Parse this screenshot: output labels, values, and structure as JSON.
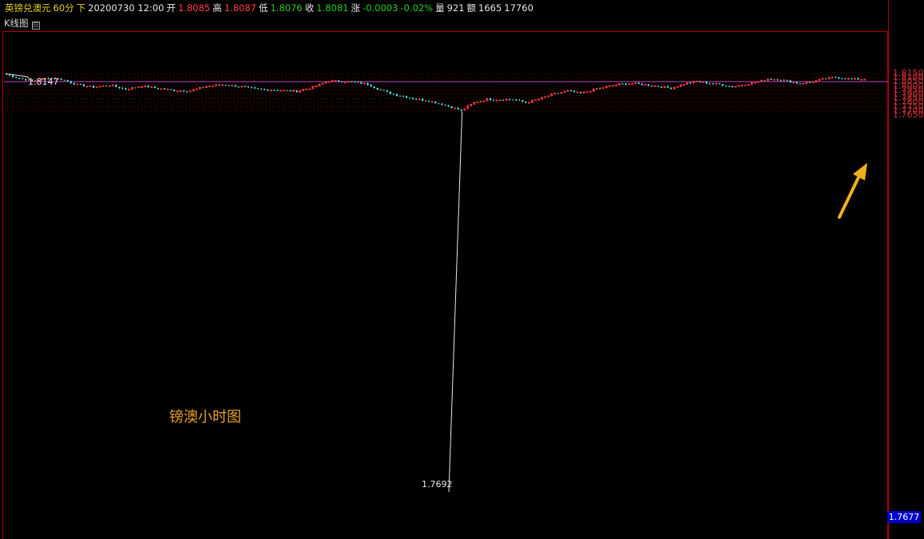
{
  "header": {
    "symbol": "英镑兑澳元",
    "period": "60分",
    "flag": "下",
    "datetime": "20200730 12:00",
    "open_label": "开",
    "open": "1.8085",
    "high_label": "高",
    "high": "1.8087",
    "low_label": "低",
    "low": "1.8076",
    "close_label": "收",
    "close": "1.8081",
    "change_label": "涨",
    "change": "-0.0003",
    "change_pct": "-0.02%",
    "volume_label": "量",
    "volume": "921",
    "amount_label": "额",
    "amount": "1665",
    "extra": "17760"
  },
  "panel": {
    "title": "K线图",
    "collapse_icon": "⊟"
  },
  "annotation": "镑澳小时图",
  "current_price": "1.7677",
  "colors": {
    "up": "#ff3c3c",
    "down": "#54ffff",
    "hline": "#c040c0",
    "arrow": "#f0b020",
    "grid": "#7a0000",
    "axis": "#b00000"
  },
  "chart_data": {
    "type": "candlestick",
    "yticks": [
      "1.8150",
      "1.8100",
      "1.8050",
      "1.8000",
      "1.7950",
      "1.7900",
      "1.7850",
      "1.7800",
      "1.7750",
      "1.7700",
      "1.7650"
    ],
    "ylim": [
      1.764,
      1.8175
    ],
    "high_marker": "1.8147",
    "low_marker": "1.7692",
    "horizontal_line": 1.8051,
    "anchors": [
      [
        0,
        1.814
      ],
      [
        3,
        1.81
      ],
      [
        8,
        1.806
      ],
      [
        13,
        1.8095
      ],
      [
        17,
        1.808
      ],
      [
        22,
        1.8015
      ],
      [
        27,
        1.7985
      ],
      [
        32,
        1.801
      ],
      [
        37,
        1.796
      ],
      [
        42,
        1.8
      ],
      [
        47,
        1.797
      ],
      [
        52,
        1.7945
      ],
      [
        57,
        1.794
      ],
      [
        62,
        1.7995
      ],
      [
        67,
        1.8015
      ],
      [
        72,
        1.7995
      ],
      [
        78,
        1.796
      ],
      [
        84,
        1.795
      ],
      [
        90,
        1.7935
      ],
      [
        95,
        1.7985
      ],
      [
        100,
        1.806
      ],
      [
        104,
        1.8055
      ],
      [
        108,
        1.8045
      ],
      [
        112,
        1.802
      ],
      [
        116,
        1.795
      ],
      [
        120,
        1.79
      ],
      [
        126,
        1.785
      ],
      [
        131,
        1.782
      ],
      [
        136,
        1.777
      ],
      [
        141,
        1.7705
      ],
      [
        145,
        1.78
      ],
      [
        149,
        1.784
      ],
      [
        153,
        1.7835
      ],
      [
        157,
        1.784
      ],
      [
        161,
        1.78
      ],
      [
        165,
        1.784
      ],
      [
        169,
        1.7895
      ],
      [
        174,
        1.794
      ],
      [
        178,
        1.791
      ],
      [
        182,
        1.7955
      ],
      [
        186,
        1.799
      ],
      [
        190,
        1.802
      ],
      [
        194,
        1.803
      ],
      [
        198,
        1.8015
      ],
      [
        202,
        1.7995
      ],
      [
        206,
        1.7975
      ],
      [
        210,
        1.8025
      ],
      [
        214,
        1.8055
      ],
      [
        217,
        1.8035
      ],
      [
        221,
        1.802
      ],
      [
        225,
        1.799
      ],
      [
        229,
        1.802
      ],
      [
        233,
        1.805
      ],
      [
        236,
        1.8085
      ],
      [
        240,
        1.8075
      ],
      [
        243,
        1.805
      ],
      [
        246,
        1.803
      ],
      [
        249,
        1.8045
      ],
      [
        253,
        1.808
      ],
      [
        257,
        1.8105
      ],
      [
        260,
        1.809
      ],
      [
        263,
        1.808
      ],
      [
        266,
        1.8084
      ]
    ]
  }
}
